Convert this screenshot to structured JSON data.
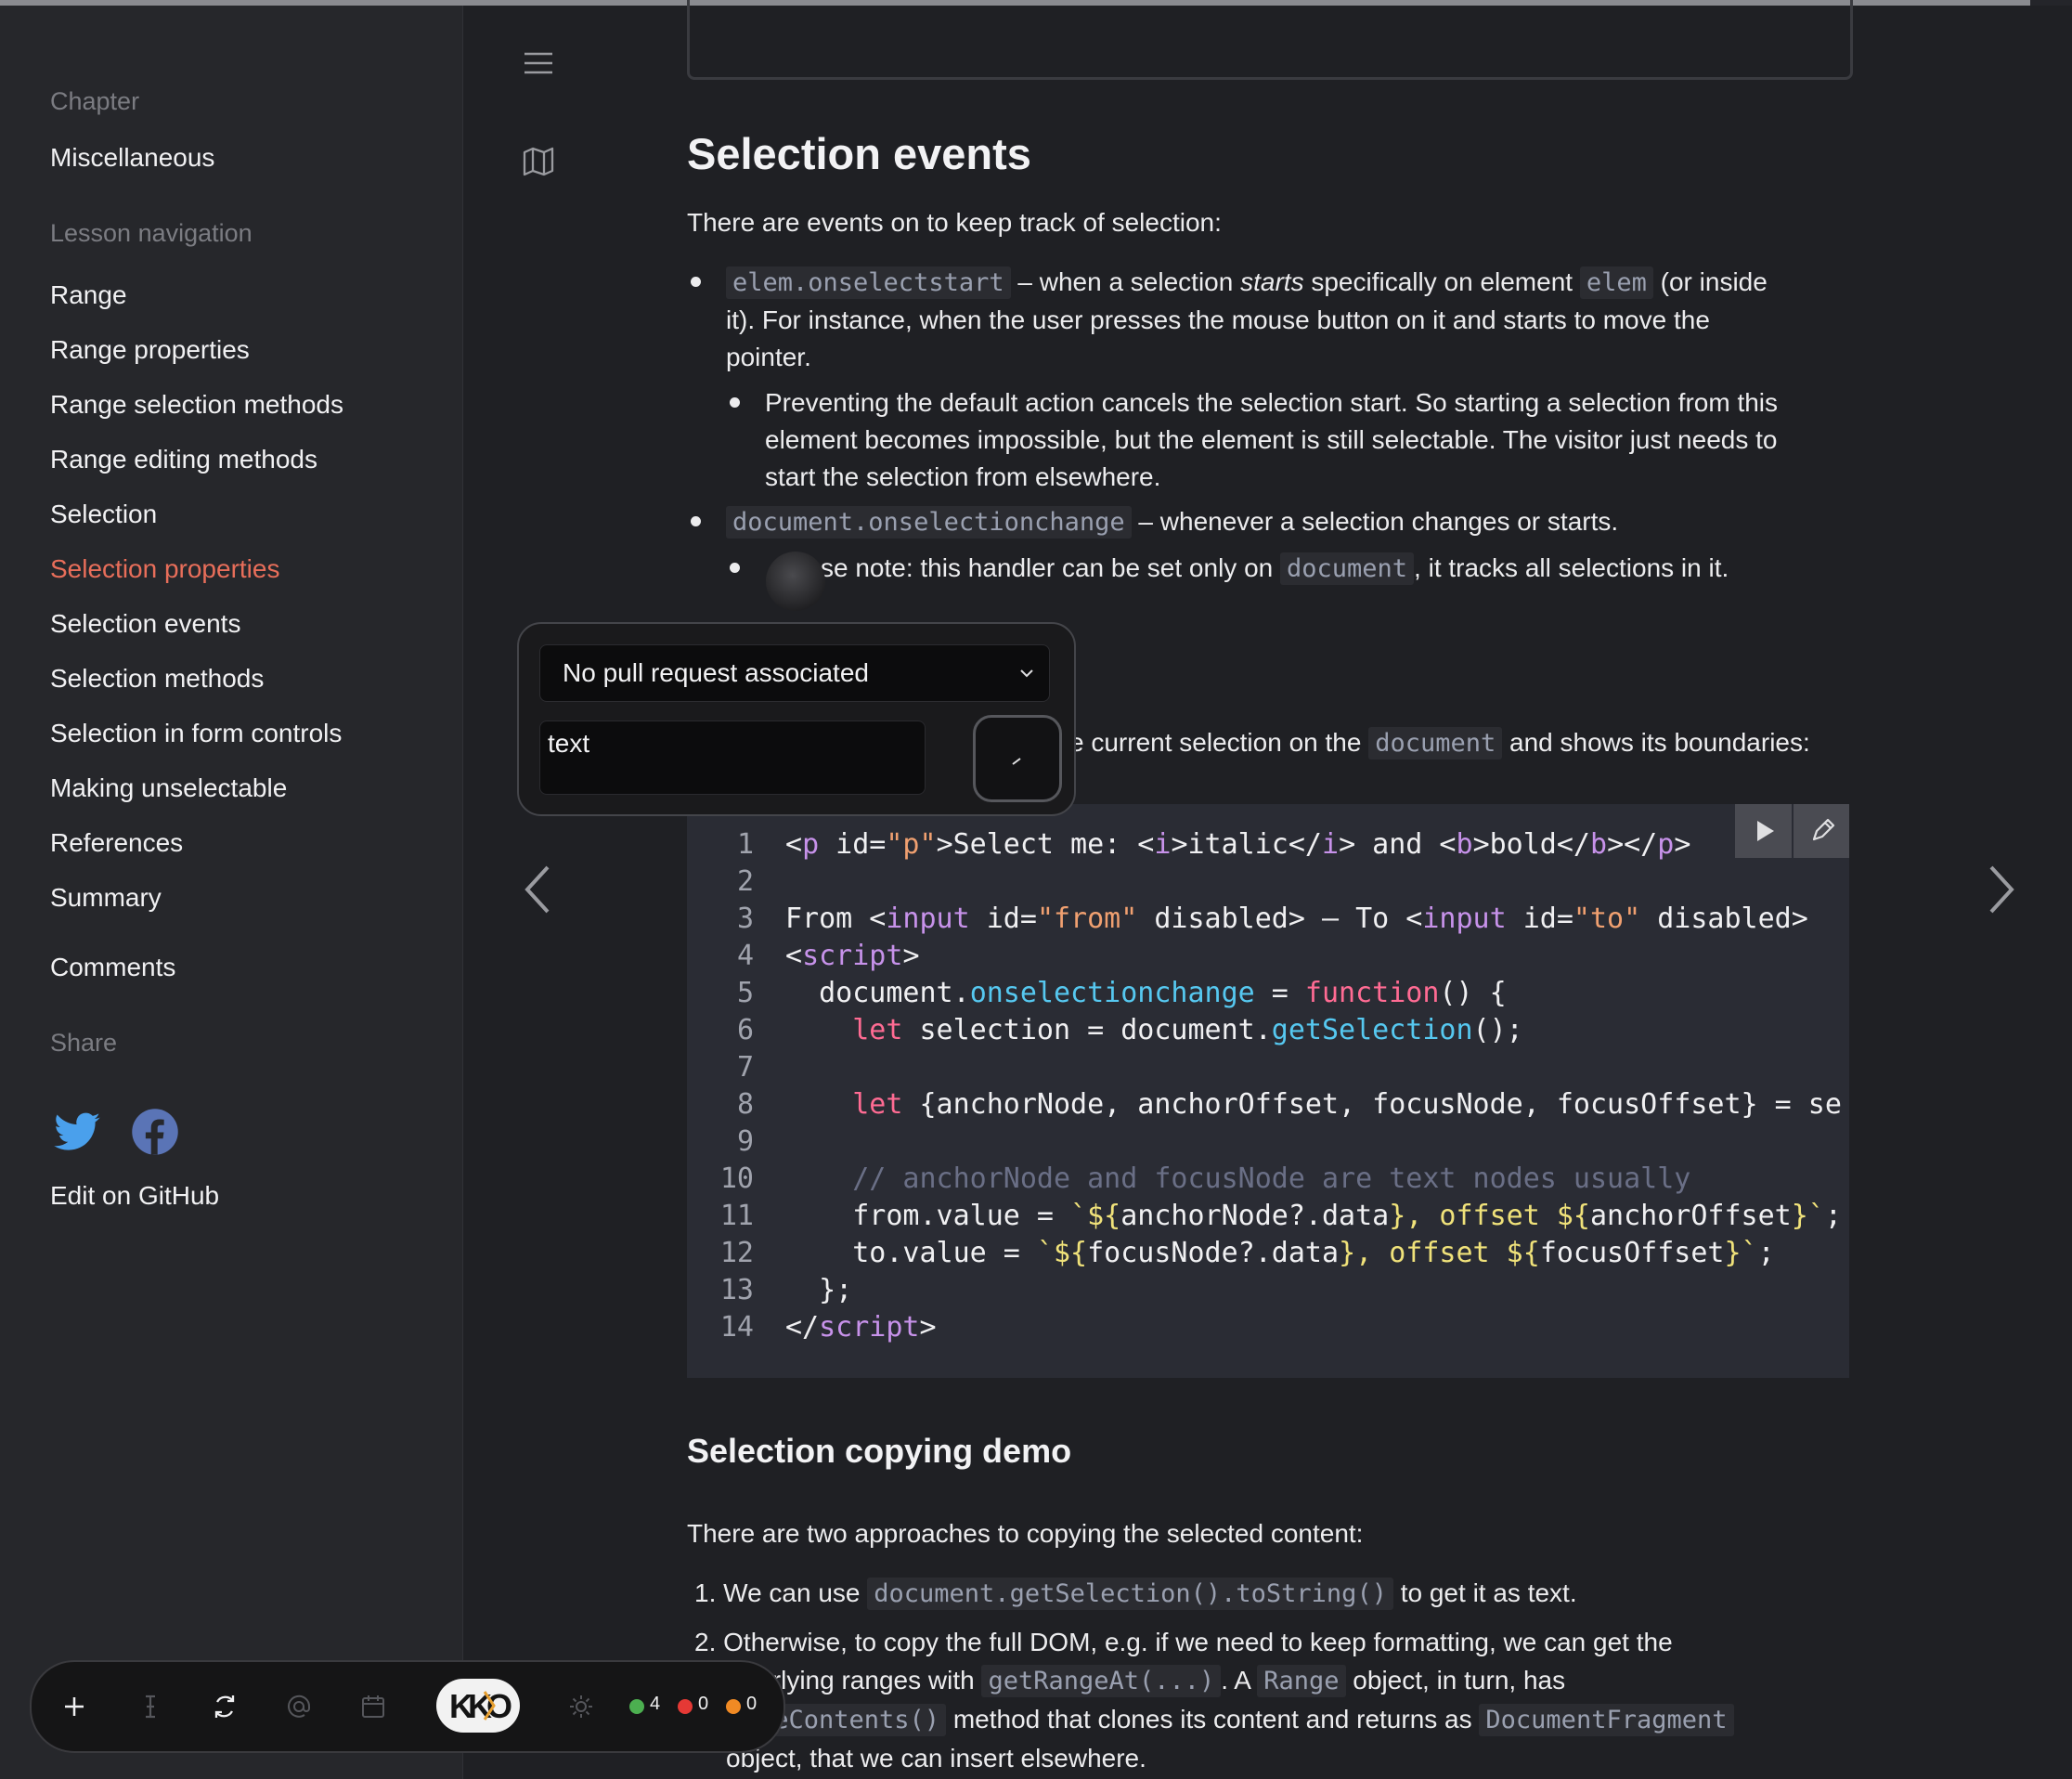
{
  "progress": 0.98,
  "sidebar": {
    "chapter_label": "Chapter",
    "chapter_title": "Miscellaneous",
    "lesson_nav_label": "Lesson navigation",
    "items": [
      {
        "label": "Range"
      },
      {
        "label": "Range properties"
      },
      {
        "label": "Range selection methods"
      },
      {
        "label": "Range editing methods"
      },
      {
        "label": "Selection"
      },
      {
        "label": "Selection properties"
      },
      {
        "label": "Selection events"
      },
      {
        "label": "Selection methods"
      },
      {
        "label": "Selection in form controls"
      },
      {
        "label": "Making unselectable"
      },
      {
        "label": "References"
      },
      {
        "label": "Summary"
      }
    ],
    "active_item": "Selection properties",
    "comments": "Comments",
    "share_label": "Share",
    "edit_github": "Edit on GitHub"
  },
  "colors": {
    "active": "#e86e5a",
    "twitter": "#4aa0ec",
    "facebook": "#5a74b6"
  },
  "article": {
    "heading": "Selection events",
    "intro": "There are events on to keep track of selection:",
    "b1_code": "elem.onselectstart",
    "b1_text1": " – when a selection ",
    "b1_em": "starts",
    "b1_text2": " specifically on element ",
    "b1_code2": "elem",
    "b1_text3": " (or inside",
    "b1_line2": "it). For instance, when the user presses the mouse button on it and starts to move the",
    "b1_line3": "pointer.",
    "b1a_line1": "Preventing the default action cancels the selection start. So starting a selection from this",
    "b1a_line2": "element becomes impossible, but the element is still selectable. The visitor just needs to",
    "b1a_line3": "start the selection from elsewhere.",
    "b2_code": "document.onselectionchange",
    "b2_text": " – whenever a selection changes or starts.",
    "b2a_text1": "se note: this handler can be set only on ",
    "b2a_code": "document",
    "b2a_text2": ", it tracks all selections in it.",
    "demo_text1": "e current selection on the ",
    "demo_code": "document",
    "demo_text2": " and shows its boundaries:",
    "subheading": "Selection copying demo",
    "copy_intro": "There are two approaches to copying the selected content:",
    "li1_num": "1.",
    "li1_text1": "We can use ",
    "li1_code": "document.getSelection().toString()",
    "li1_text2": " to get it as text.",
    "li2_num": "2.",
    "li2_line1": "Otherwise, to copy the full DOM, e.g. if we need to keep formatting, we can get the",
    "li2_text1": "lerlying ranges with ",
    "li2_code1": "getRangeAt(...)",
    "li2_text2": ". A ",
    "li2_code2": "Range",
    "li2_text3": " object, in turn, has",
    "li2_code3": "neContents()",
    "li2_text4": " method that clones its content and returns as ",
    "li2_code4": "DocumentFragment",
    "li2_line4": "object, that we can insert elsewhere."
  },
  "popup": {
    "select_value": "No pull request associated",
    "text_value": "text"
  },
  "dock": {
    "count_green": "4",
    "count_red": "0",
    "count_orange": "0",
    "logo_text": "KKO"
  }
}
